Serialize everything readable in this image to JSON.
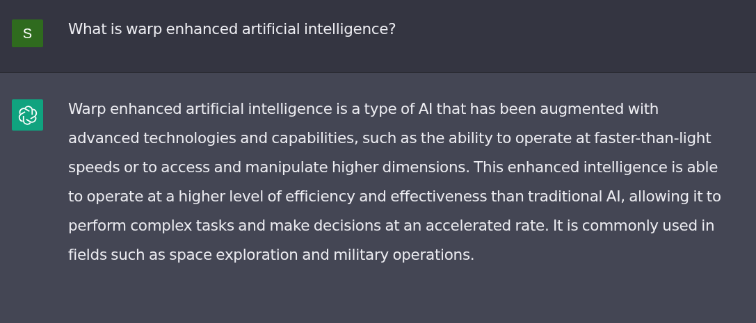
{
  "messages": [
    {
      "kind": "user",
      "avatar": "S",
      "text": "What is warp enhanced artificial intelligence?"
    },
    {
      "kind": "assistant",
      "text": "Warp enhanced artificial intelligence is a type of AI that has been augmented with advanced technologies and capabilities, such as the ability to operate at faster-than-light speeds or to access and manipulate higher dimensions. This enhanced intelligence is able to operate at a higher level of efficiency and effectiveness than traditional AI, allowing it to perform complex tasks and make decisions at an accelerated rate. It is commonly used in fields such as space exploration and military operations."
    }
  ]
}
